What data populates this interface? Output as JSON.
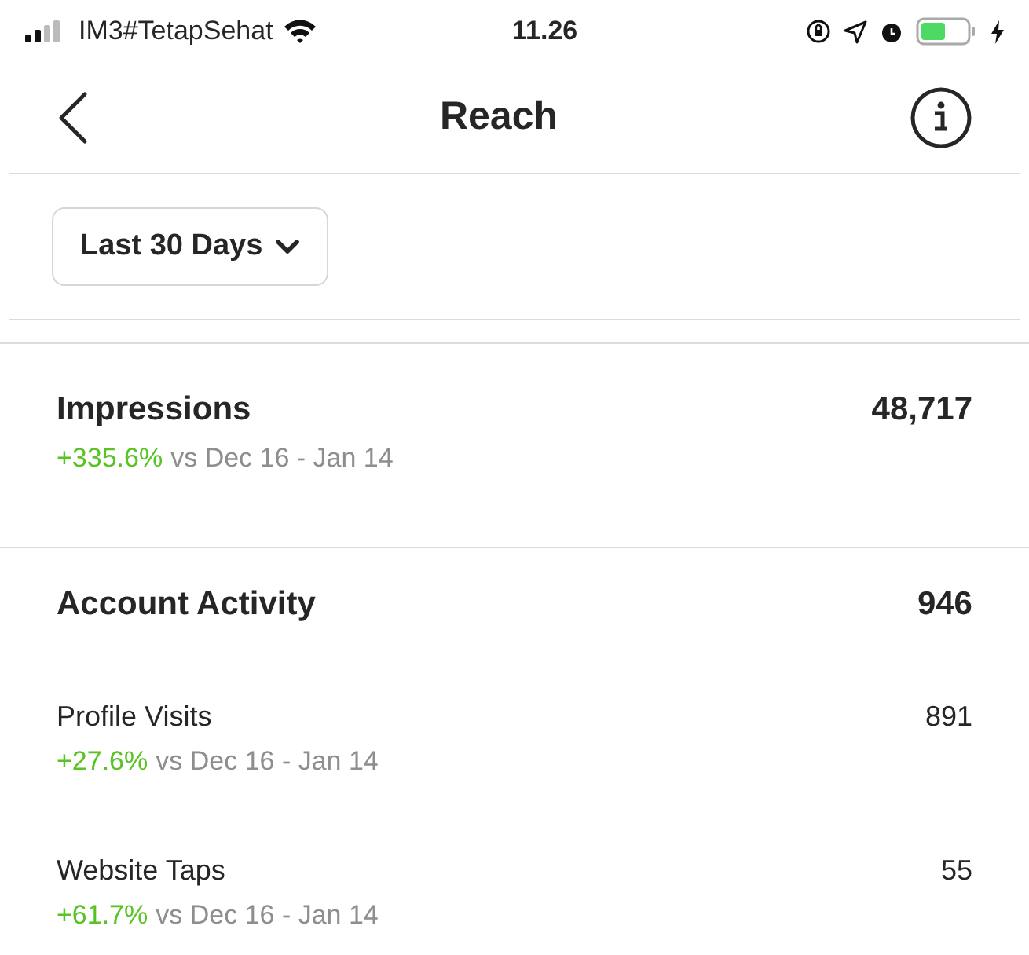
{
  "status_bar": {
    "carrier": "IM3#TetapSehat",
    "time": "11.26"
  },
  "header": {
    "title": "Reach"
  },
  "filter": {
    "label": "Last 30 Days"
  },
  "sections": [
    {
      "kind": "main",
      "title": "Impressions",
      "value": "48,717",
      "change": "+335.6%",
      "comparison": "vs Dec 16 - Jan 14"
    },
    {
      "kind": "main",
      "title": "Account Activity",
      "value": "946"
    },
    {
      "kind": "sub",
      "title": "Profile Visits",
      "value": "891",
      "change": "+27.6%",
      "comparison": "vs Dec 16 - Jan 14"
    },
    {
      "kind": "sub",
      "title": "Website Taps",
      "value": "55",
      "change": "+61.7%",
      "comparison": "vs Dec 16 - Jan 14"
    }
  ]
}
